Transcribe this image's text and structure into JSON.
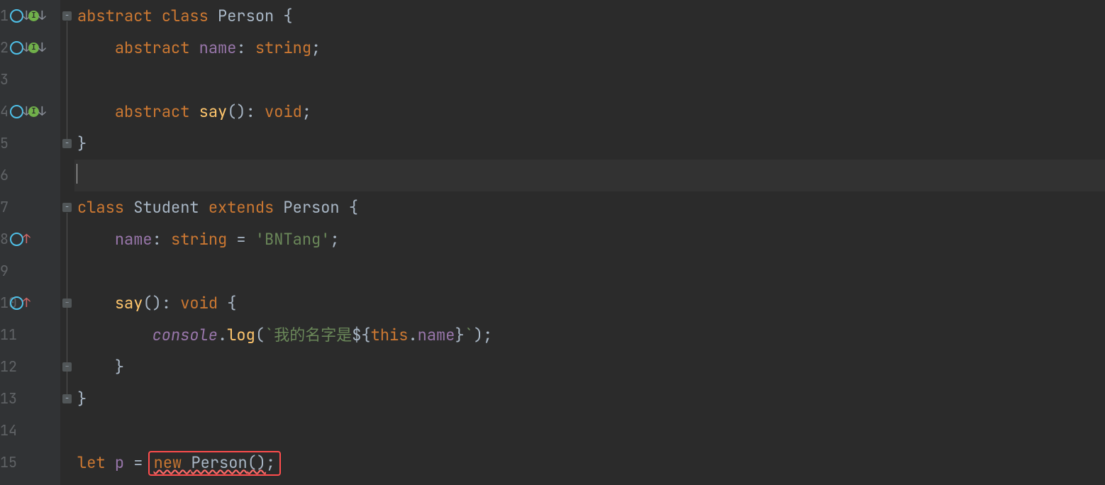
{
  "lineHeight": 45,
  "lines": [
    {
      "n": "1",
      "icons": [
        "override-down",
        "impl-down"
      ],
      "fold": "open-top",
      "tokens": [
        [
          "kw",
          "abstract "
        ],
        [
          "kw",
          "class "
        ],
        [
          "cls",
          "Person "
        ],
        [
          "punct",
          "{"
        ]
      ]
    },
    {
      "n": "2",
      "icons": [
        "override-down",
        "impl-down"
      ],
      "tokens": [
        [
          "pad",
          "    "
        ],
        [
          "kw",
          "abstract "
        ],
        [
          "prop",
          "name"
        ],
        [
          "punct",
          ": "
        ],
        [
          "kw",
          "string"
        ],
        [
          "punct",
          ";"
        ]
      ]
    },
    {
      "n": "3",
      "tokens": []
    },
    {
      "n": "4",
      "icons": [
        "override-down",
        "impl-down"
      ],
      "tokens": [
        [
          "pad",
          "    "
        ],
        [
          "kw",
          "abstract "
        ],
        [
          "fn",
          "say"
        ],
        [
          "punct",
          "(): "
        ],
        [
          "kw",
          "void"
        ],
        [
          "punct",
          ";"
        ]
      ]
    },
    {
      "n": "5",
      "fold": "close",
      "tokens": [
        [
          "punct",
          "}"
        ]
      ]
    },
    {
      "n": "6",
      "current": true,
      "caret": true,
      "tokens": []
    },
    {
      "n": "7",
      "fold": "open-top",
      "tokens": [
        [
          "kw",
          "class "
        ],
        [
          "cls",
          "Student "
        ],
        [
          "kw",
          "extends "
        ],
        [
          "cls",
          "Person "
        ],
        [
          "punct",
          "{"
        ]
      ]
    },
    {
      "n": "8",
      "icons": [
        "override-up"
      ],
      "tokens": [
        [
          "pad",
          "    "
        ],
        [
          "prop",
          "name"
        ],
        [
          "punct",
          ": "
        ],
        [
          "kw",
          "string"
        ],
        [
          "punct",
          " = "
        ],
        [
          "str",
          "'BNTang'"
        ],
        [
          "punct",
          ";"
        ]
      ]
    },
    {
      "n": "9",
      "tokens": []
    },
    {
      "n": "10",
      "icons": [
        "override-up"
      ],
      "fold": "open-inner",
      "tokens": [
        [
          "pad",
          "    "
        ],
        [
          "fn",
          "say"
        ],
        [
          "punct",
          "(): "
        ],
        [
          "kw",
          "void"
        ],
        [
          "punct",
          " {"
        ]
      ]
    },
    {
      "n": "11",
      "tokens": [
        [
          "pad",
          "        "
        ],
        [
          "it prop",
          "console"
        ],
        [
          "punct",
          "."
        ],
        [
          "fn",
          "log"
        ],
        [
          "punct",
          "("
        ],
        [
          "tpl",
          "`我的名字是"
        ],
        [
          "punct",
          "${"
        ],
        [
          "kw",
          "this"
        ],
        [
          "punct",
          "."
        ],
        [
          "prop",
          "name"
        ],
        [
          "punct",
          "}"
        ],
        [
          "tpl",
          "`"
        ],
        [
          "punct",
          ");"
        ]
      ]
    },
    {
      "n": "12",
      "fold": "close-inner",
      "tokens": [
        [
          "pad",
          "    "
        ],
        [
          "punct",
          "}"
        ]
      ]
    },
    {
      "n": "13",
      "fold": "close",
      "tokens": [
        [
          "punct",
          "}"
        ]
      ]
    },
    {
      "n": "14",
      "tokens": []
    },
    {
      "n": "15",
      "tokens": [
        [
          "kw",
          "let "
        ],
        [
          "prop",
          "p"
        ],
        [
          "punct",
          " = "
        ],
        [
          "errbox-start",
          ""
        ],
        [
          "kw err-underline",
          "new "
        ],
        [
          "cls err-underline",
          "Person"
        ],
        [
          "punct err-underline",
          "()"
        ],
        [
          "punct",
          ";"
        ],
        [
          "errbox-end",
          ""
        ]
      ]
    }
  ],
  "iconGlyphs": {
    "override-down": "O↓I↓",
    "impl-down": "",
    "override-up": "O↑"
  },
  "colors": {
    "errorBox": "#ff4d4d"
  }
}
